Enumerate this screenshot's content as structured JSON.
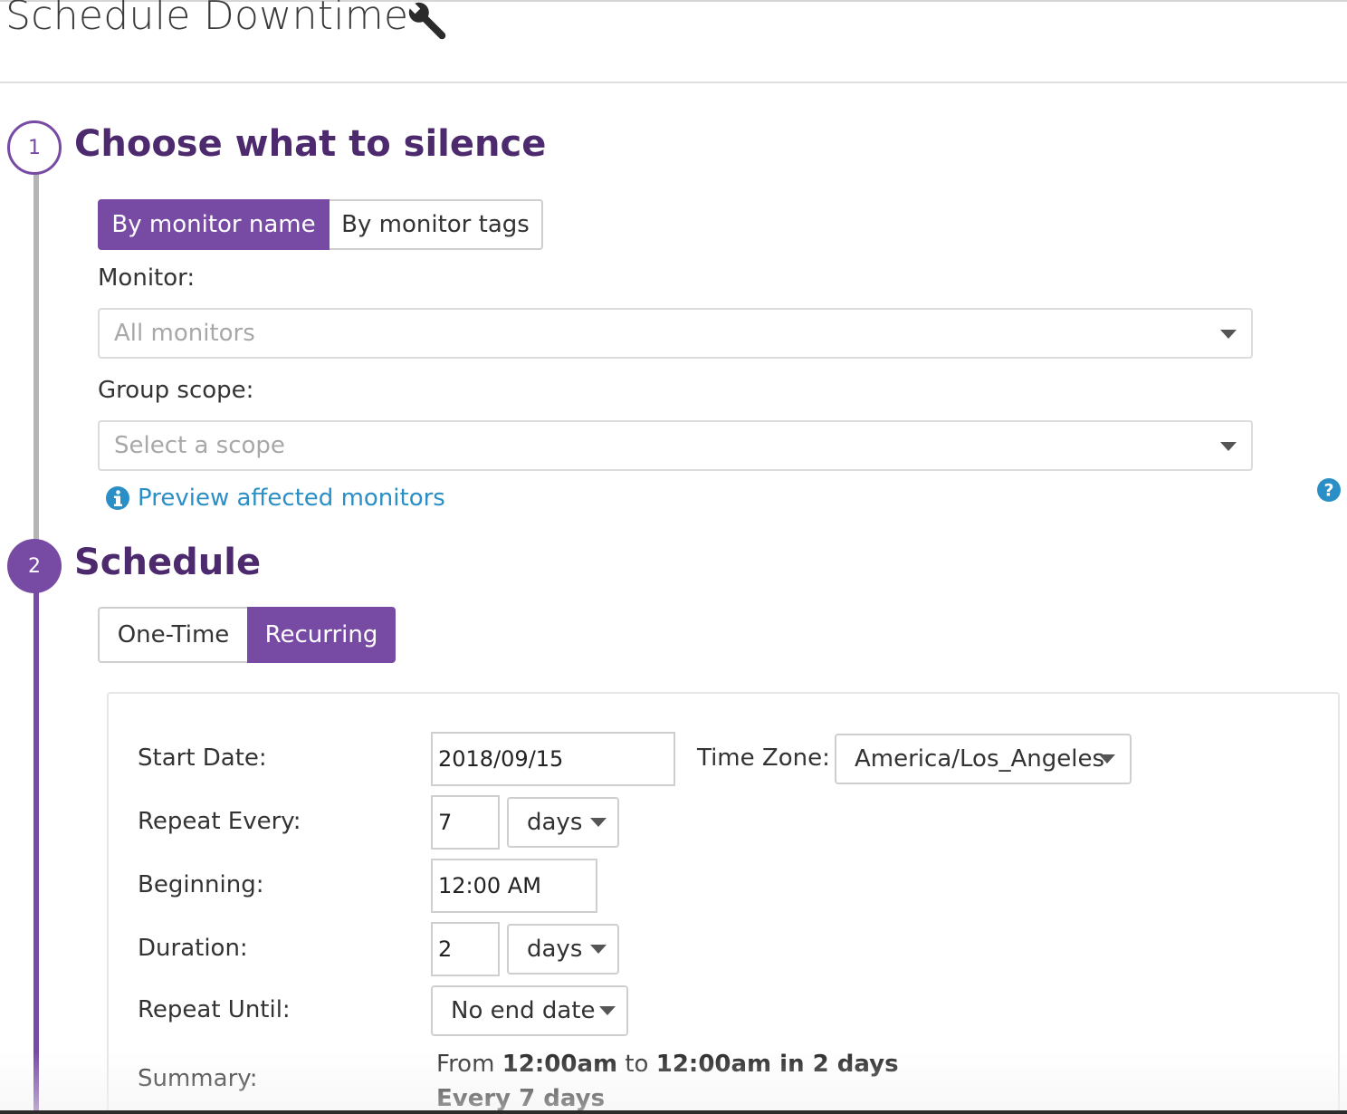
{
  "header": {
    "title": "Schedule Downtime",
    "icon": "wrench-icon"
  },
  "steps": [
    {
      "number": "1",
      "title": "Choose what to silence"
    },
    {
      "number": "2",
      "title": "Schedule"
    }
  ],
  "silence": {
    "tabs": [
      "By monitor name",
      "By monitor tags"
    ],
    "active_tab": "By monitor name",
    "monitor_label": "Monitor:",
    "monitor_placeholder": "All monitors",
    "scope_label": "Group scope:",
    "scope_placeholder": "Select a scope",
    "preview_link": "Preview affected monitors",
    "help_icon": "question-circle-icon",
    "info_icon": "info-circle-icon"
  },
  "schedule": {
    "tabs": [
      "One-Time",
      "Recurring"
    ],
    "active_tab": "Recurring",
    "start_date_label": "Start Date:",
    "start_date": "2018/09/15",
    "timezone_label": "Time Zone:",
    "timezone": "America/Los_Angeles",
    "repeat_label": "Repeat Every:",
    "repeat_value": "7",
    "repeat_unit": "days",
    "beginning_label": "Beginning:",
    "beginning_value": "12:00  AM",
    "duration_label": "Duration:",
    "duration_value": "2",
    "duration_unit": "days",
    "until_label": "Repeat Until:",
    "until_value": "No end date",
    "summary_label": "Summary:",
    "summary": {
      "from": "From",
      "start": "12:00am",
      "to": "to",
      "end": "12:00am in 2 days",
      "every": "Every 7 days"
    }
  },
  "colors": {
    "accent": "#774aa4",
    "heading": "#4d2a6e",
    "link": "#2a8fc6"
  }
}
